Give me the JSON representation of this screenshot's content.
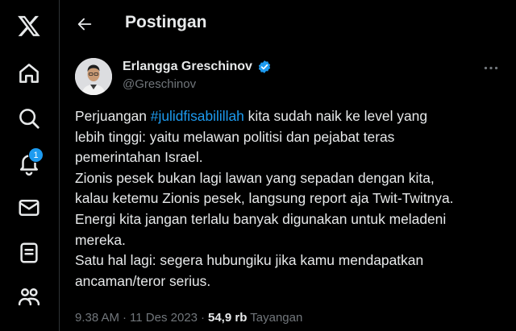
{
  "header": {
    "title": "Postingan"
  },
  "sidebar": {
    "items": [
      {
        "name": "x-logo"
      },
      {
        "name": "home"
      },
      {
        "name": "explore"
      },
      {
        "name": "notifications",
        "badge": "1"
      },
      {
        "name": "messages"
      },
      {
        "name": "lists"
      },
      {
        "name": "communities"
      }
    ]
  },
  "post": {
    "author_name": "Erlangga Greschinov",
    "author_handle": "@Greschinov",
    "lines": [
      {
        "before": "Perjuangan ",
        "hashtag": "#julidfisabilillah",
        "after": " kita sudah naik ke level yang"
      },
      "lebih tinggi: yaitu melawan politisi dan pejabat teras",
      "pemerintahan Israel.",
      "Zionis pesek bukan lagi lawan yang sepadan dengan kita,",
      "kalau ketemu Zionis pesek, langsung report aja Twit-Twitnya.",
      "Energi kita jangan terlalu banyak digunakan untuk meladeni",
      "mereka.",
      "Satu hal lagi: segera hubungiku jika kamu mendapatkan",
      "ancaman/teror serius."
    ],
    "time": "9.38 AM",
    "date": "11 Des 2023",
    "views_count": "54,9 rb",
    "views_label": "Tayangan",
    "separator": "·"
  },
  "colors": {
    "background": "#000000",
    "text": "#e7e9ea",
    "muted": "#71767b",
    "accent": "#1d9bf0"
  }
}
